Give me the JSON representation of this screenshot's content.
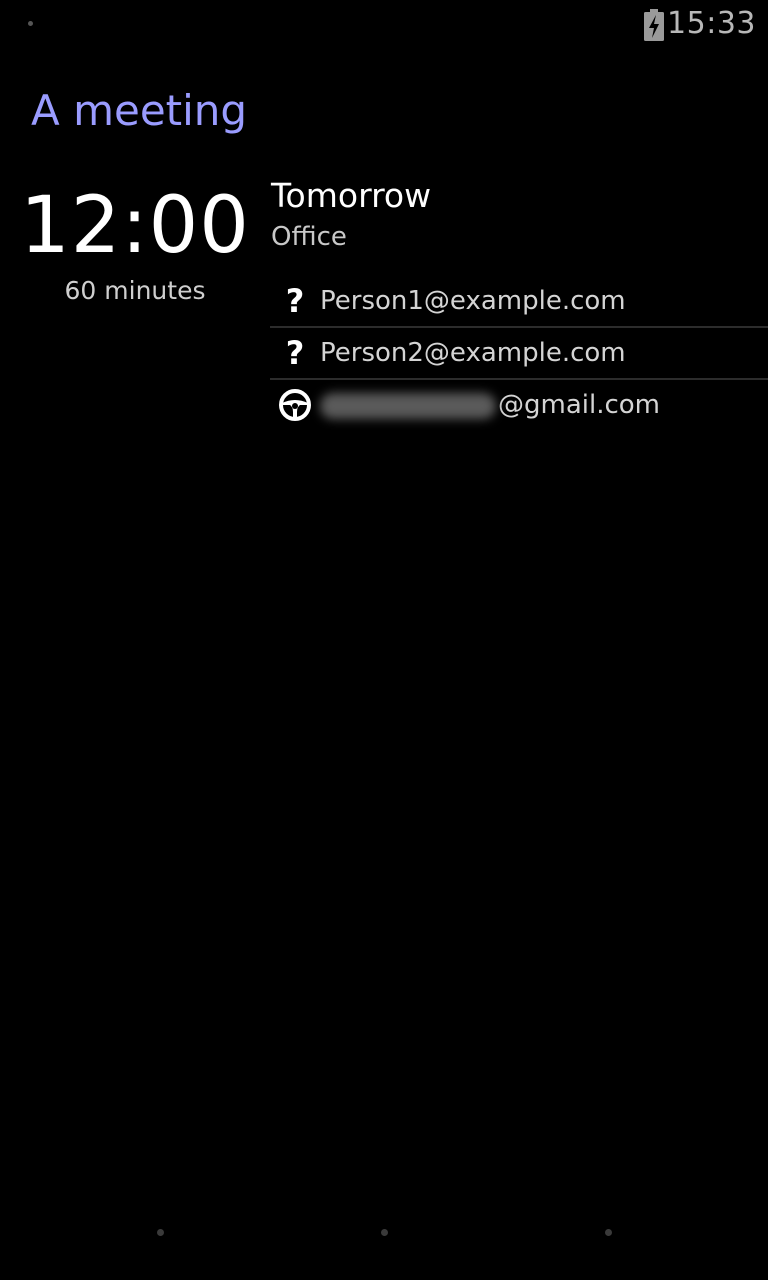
{
  "status_bar": {
    "time": "15:33",
    "battery_icon": "battery-charging-icon",
    "notification_icon": "notification-dot-icon"
  },
  "event": {
    "title": "A meeting",
    "start_time": "12:00",
    "duration": "60 minutes",
    "day": "Tomorrow",
    "location": "Office",
    "accent_color": "#9a9cff"
  },
  "guests": [
    {
      "icon": "question-icon",
      "email": "Person1@example.com"
    },
    {
      "icon": "question-icon",
      "email": "Person2@example.com"
    },
    {
      "icon": "steering-wheel-icon",
      "email": "@gmail.com"
    }
  ],
  "navigation": {
    "icons": [
      "nav-back-dot-icon",
      "nav-home-dot-icon",
      "nav-recent-dot-icon"
    ]
  }
}
